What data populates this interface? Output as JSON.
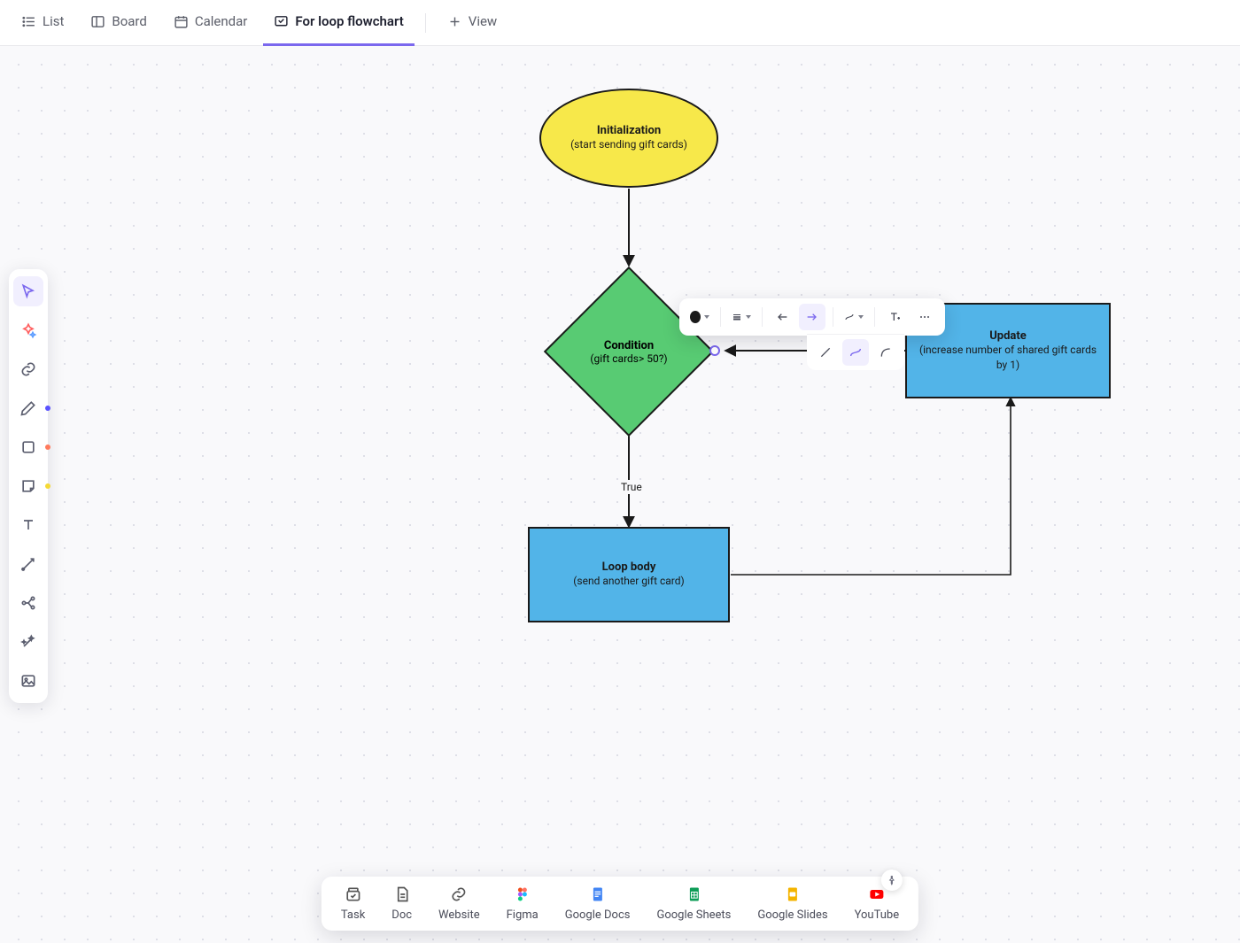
{
  "tabs": {
    "list": "List",
    "board": "Board",
    "calendar": "Calendar",
    "flowchart": "For loop flowchart",
    "add_view": "View"
  },
  "flowchart": {
    "initialization": {
      "title": "Initialization",
      "sub": "(start sending gift cards)"
    },
    "condition": {
      "title": "Condition",
      "sub": "(gift cards> 50?)"
    },
    "update": {
      "title": "Update",
      "sub": "(increase number of shared gift cards by 1)"
    },
    "loop_body": {
      "title": "Loop body",
      "sub": "(send another gift card)"
    },
    "edge_true": "True"
  },
  "side_tools": {
    "select": "select",
    "shapes": "ai-shapes",
    "link": "link",
    "pen": "pen-tool",
    "rect": "rectangle-tool",
    "sticky": "sticky-note-tool",
    "text": "text-tool",
    "connector": "connector-tool",
    "mindmap": "mindmap-tool",
    "ai": "ai-tool",
    "image": "image-tool"
  },
  "dock": {
    "task": "Task",
    "doc": "Doc",
    "website": "Website",
    "figma": "Figma",
    "gdocs": "Google Docs",
    "gsheets": "Google Sheets",
    "gslides": "Google Slides",
    "youtube": "YouTube"
  },
  "connector_toolbar": {
    "color": "#1a1a1a",
    "style": "solid",
    "start": "none",
    "end": "arrow",
    "path": "step",
    "row2_style": "step"
  },
  "chart_data": {
    "type": "flowchart",
    "title": "For loop flowchart",
    "nodes": [
      {
        "id": "init",
        "type": "terminator",
        "label": "Initialization",
        "detail": "(start sending gift cards)"
      },
      {
        "id": "cond",
        "type": "decision",
        "label": "Condition",
        "detail": "(gift cards> 50?)"
      },
      {
        "id": "body",
        "type": "process",
        "label": "Loop body",
        "detail": "(send another gift card)"
      },
      {
        "id": "update",
        "type": "process",
        "label": "Update",
        "detail": "(increase number of shared gift cards by 1)"
      }
    ],
    "edges": [
      {
        "from": "init",
        "to": "cond",
        "label": ""
      },
      {
        "from": "cond",
        "to": "body",
        "label": "True"
      },
      {
        "from": "body",
        "to": "update",
        "label": ""
      },
      {
        "from": "update",
        "to": "cond",
        "label": ""
      }
    ]
  }
}
